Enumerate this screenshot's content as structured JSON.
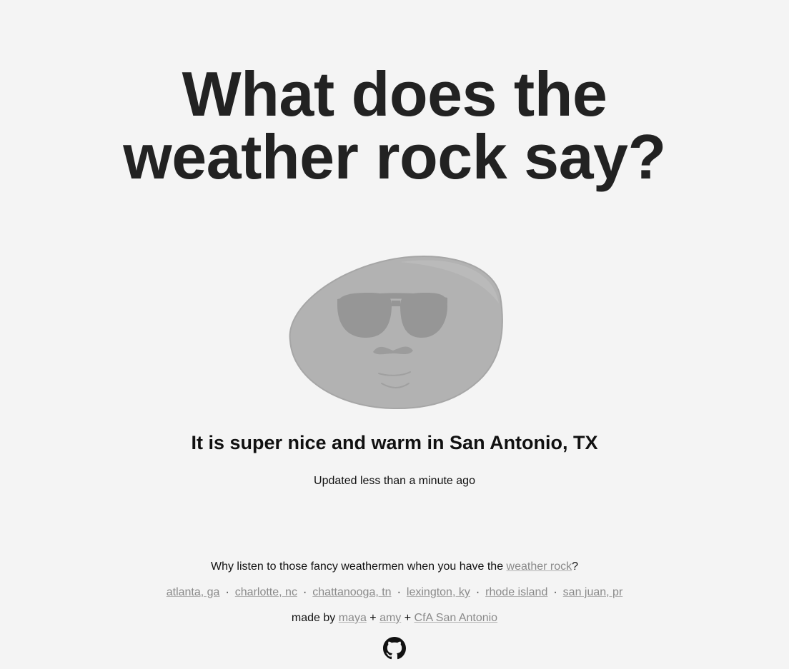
{
  "header": {
    "title_line1": "What does the",
    "title_line2": "weather rock say?"
  },
  "rock": {
    "icon": "weather-rock-sunglasses-icon",
    "body_color": "#b2b2b2",
    "glasses_color": "#969696"
  },
  "status": {
    "message": "It is super nice and warm in San Antonio, TX",
    "updated": "Updated less than a minute ago"
  },
  "footer": {
    "why_prefix": "Why listen to those fancy weathermen when you have the ",
    "why_link": "weather rock",
    "why_suffix": "?",
    "cities": [
      "atlanta, ga",
      "charlotte, nc",
      "chattanooga, tn",
      "lexington, ky",
      "rhode island",
      "san juan, pr"
    ],
    "separator": "·",
    "made_by_prefix": "made by ",
    "author1": "maya",
    "plus": " + ",
    "author2": "amy",
    "org": "CfA San Antonio",
    "github_icon": "github-icon"
  },
  "colors": {
    "background": "#f4f4f4",
    "text": "#222222",
    "link": "#8a8a8a"
  }
}
